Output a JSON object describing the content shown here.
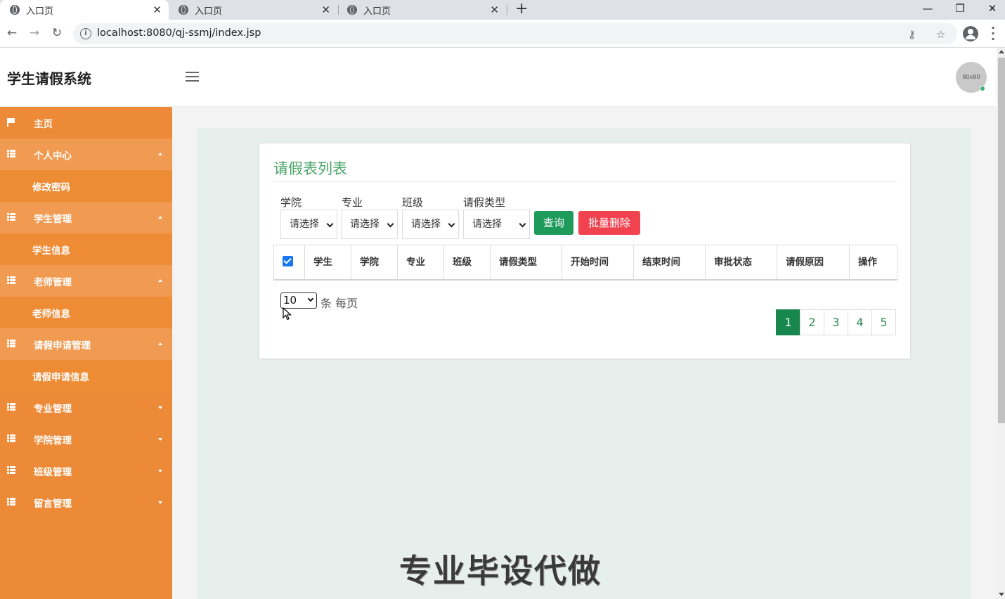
{
  "browser": {
    "tabs": [
      {
        "title": "入口页",
        "active": true
      },
      {
        "title": "入口页",
        "active": false
      },
      {
        "title": "入口页",
        "active": false
      }
    ],
    "url": "localhost:8080/qj-ssmj/index.jsp"
  },
  "header": {
    "brand": "学生请假系统",
    "avatar_text": "80x80"
  },
  "sidebar": {
    "items": [
      {
        "label": "主页",
        "type": "plain",
        "icon": "flag-icon"
      },
      {
        "label": "个人中心",
        "type": "group",
        "icon": "grid-icon",
        "caret": "up"
      },
      {
        "label": "修改密码",
        "type": "sub"
      },
      {
        "label": "学生管理",
        "type": "group",
        "icon": "grid-icon",
        "caret": "up"
      },
      {
        "label": "学生信息",
        "type": "sub"
      },
      {
        "label": "老师管理",
        "type": "group",
        "icon": "grid-icon",
        "caret": "up"
      },
      {
        "label": "老师信息",
        "type": "sub"
      },
      {
        "label": "请假申请管理",
        "type": "group",
        "icon": "grid-icon",
        "caret": "up"
      },
      {
        "label": "请假申请信息",
        "type": "sub"
      },
      {
        "label": "专业管理",
        "type": "plain",
        "icon": "grid-icon",
        "caret": "down"
      },
      {
        "label": "学院管理",
        "type": "plain",
        "icon": "grid-icon",
        "caret": "down"
      },
      {
        "label": "班级管理",
        "type": "plain",
        "icon": "grid-icon",
        "caret": "down"
      },
      {
        "label": "留言管理",
        "type": "plain",
        "icon": "grid-icon",
        "caret": "down"
      }
    ]
  },
  "main": {
    "title": "请假表列表",
    "filters": [
      {
        "label": "学院",
        "value": "请选择"
      },
      {
        "label": "专业",
        "value": "请选择"
      },
      {
        "label": "班级",
        "value": "请选择"
      },
      {
        "label": "请假类型",
        "value": "请选择"
      }
    ],
    "query_button": "查询",
    "delete_button": "批量删除",
    "columns": [
      "学生",
      "学院",
      "专业",
      "班级",
      "请假类型",
      "开始时间",
      "结束时间",
      "审批状态",
      "请假原因",
      "操作"
    ],
    "page_size": "10",
    "page_size_label": "条 每页",
    "pages": [
      "1",
      "2",
      "3",
      "4",
      "5"
    ],
    "current_page": "1"
  },
  "watermark": "专业毕设代做",
  "colors": {
    "sidebar": "#ed8a38",
    "accent_green": "#1e9a5a",
    "danger": "#f0434f",
    "title_green": "#4aa46a"
  }
}
